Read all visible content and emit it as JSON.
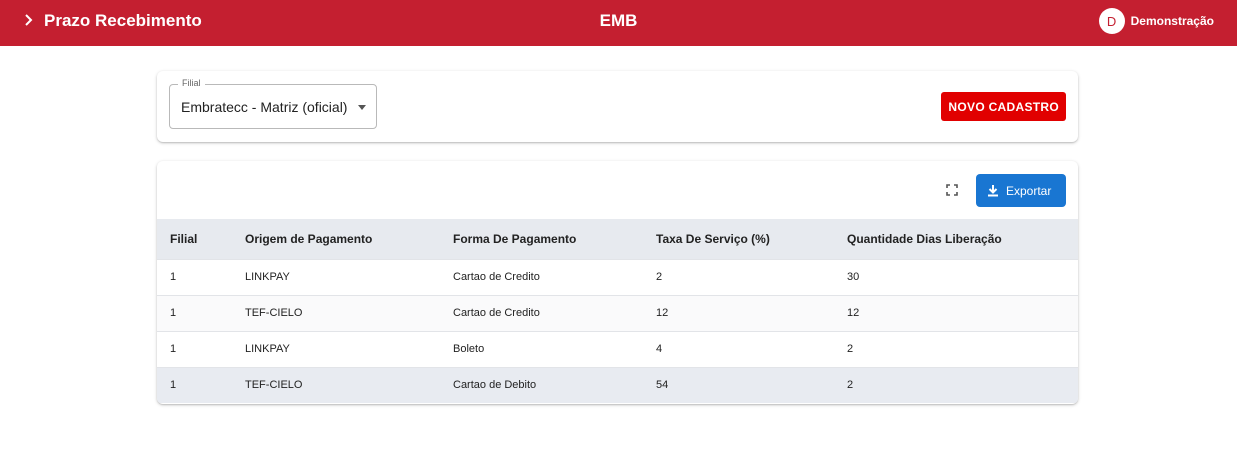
{
  "header": {
    "title": "Prazo Recebimento",
    "center": "EMB",
    "user_initial": "D",
    "user_name": "Demonstração",
    "color": "#c41f30"
  },
  "filter": {
    "legend": "Filial",
    "value": "Embratecc - Matriz (oficial)"
  },
  "buttons": {
    "novo_cadastro": "NOVO CADASTRO",
    "exportar": "Exportar"
  },
  "table": {
    "columns": [
      "Filial",
      "Origem de Pagamento",
      "Forma De Pagamento",
      "Taxa De Serviço (%)",
      "Quantidade Dias Liberação"
    ],
    "rows": [
      [
        "1",
        "LINKPAY",
        "Cartao de Credito",
        "2",
        "30"
      ],
      [
        "1",
        "TEF-CIELO",
        "Cartao de Credito",
        "12",
        "12"
      ],
      [
        "1",
        "LINKPAY",
        "Boleto",
        "4",
        "2"
      ],
      [
        "1",
        "TEF-CIELO",
        "Cartao de Debito",
        "54",
        "2"
      ]
    ]
  },
  "colors": {
    "accent": "#c41f30",
    "primary_button": "#e10000",
    "export_button": "#1976d2"
  }
}
